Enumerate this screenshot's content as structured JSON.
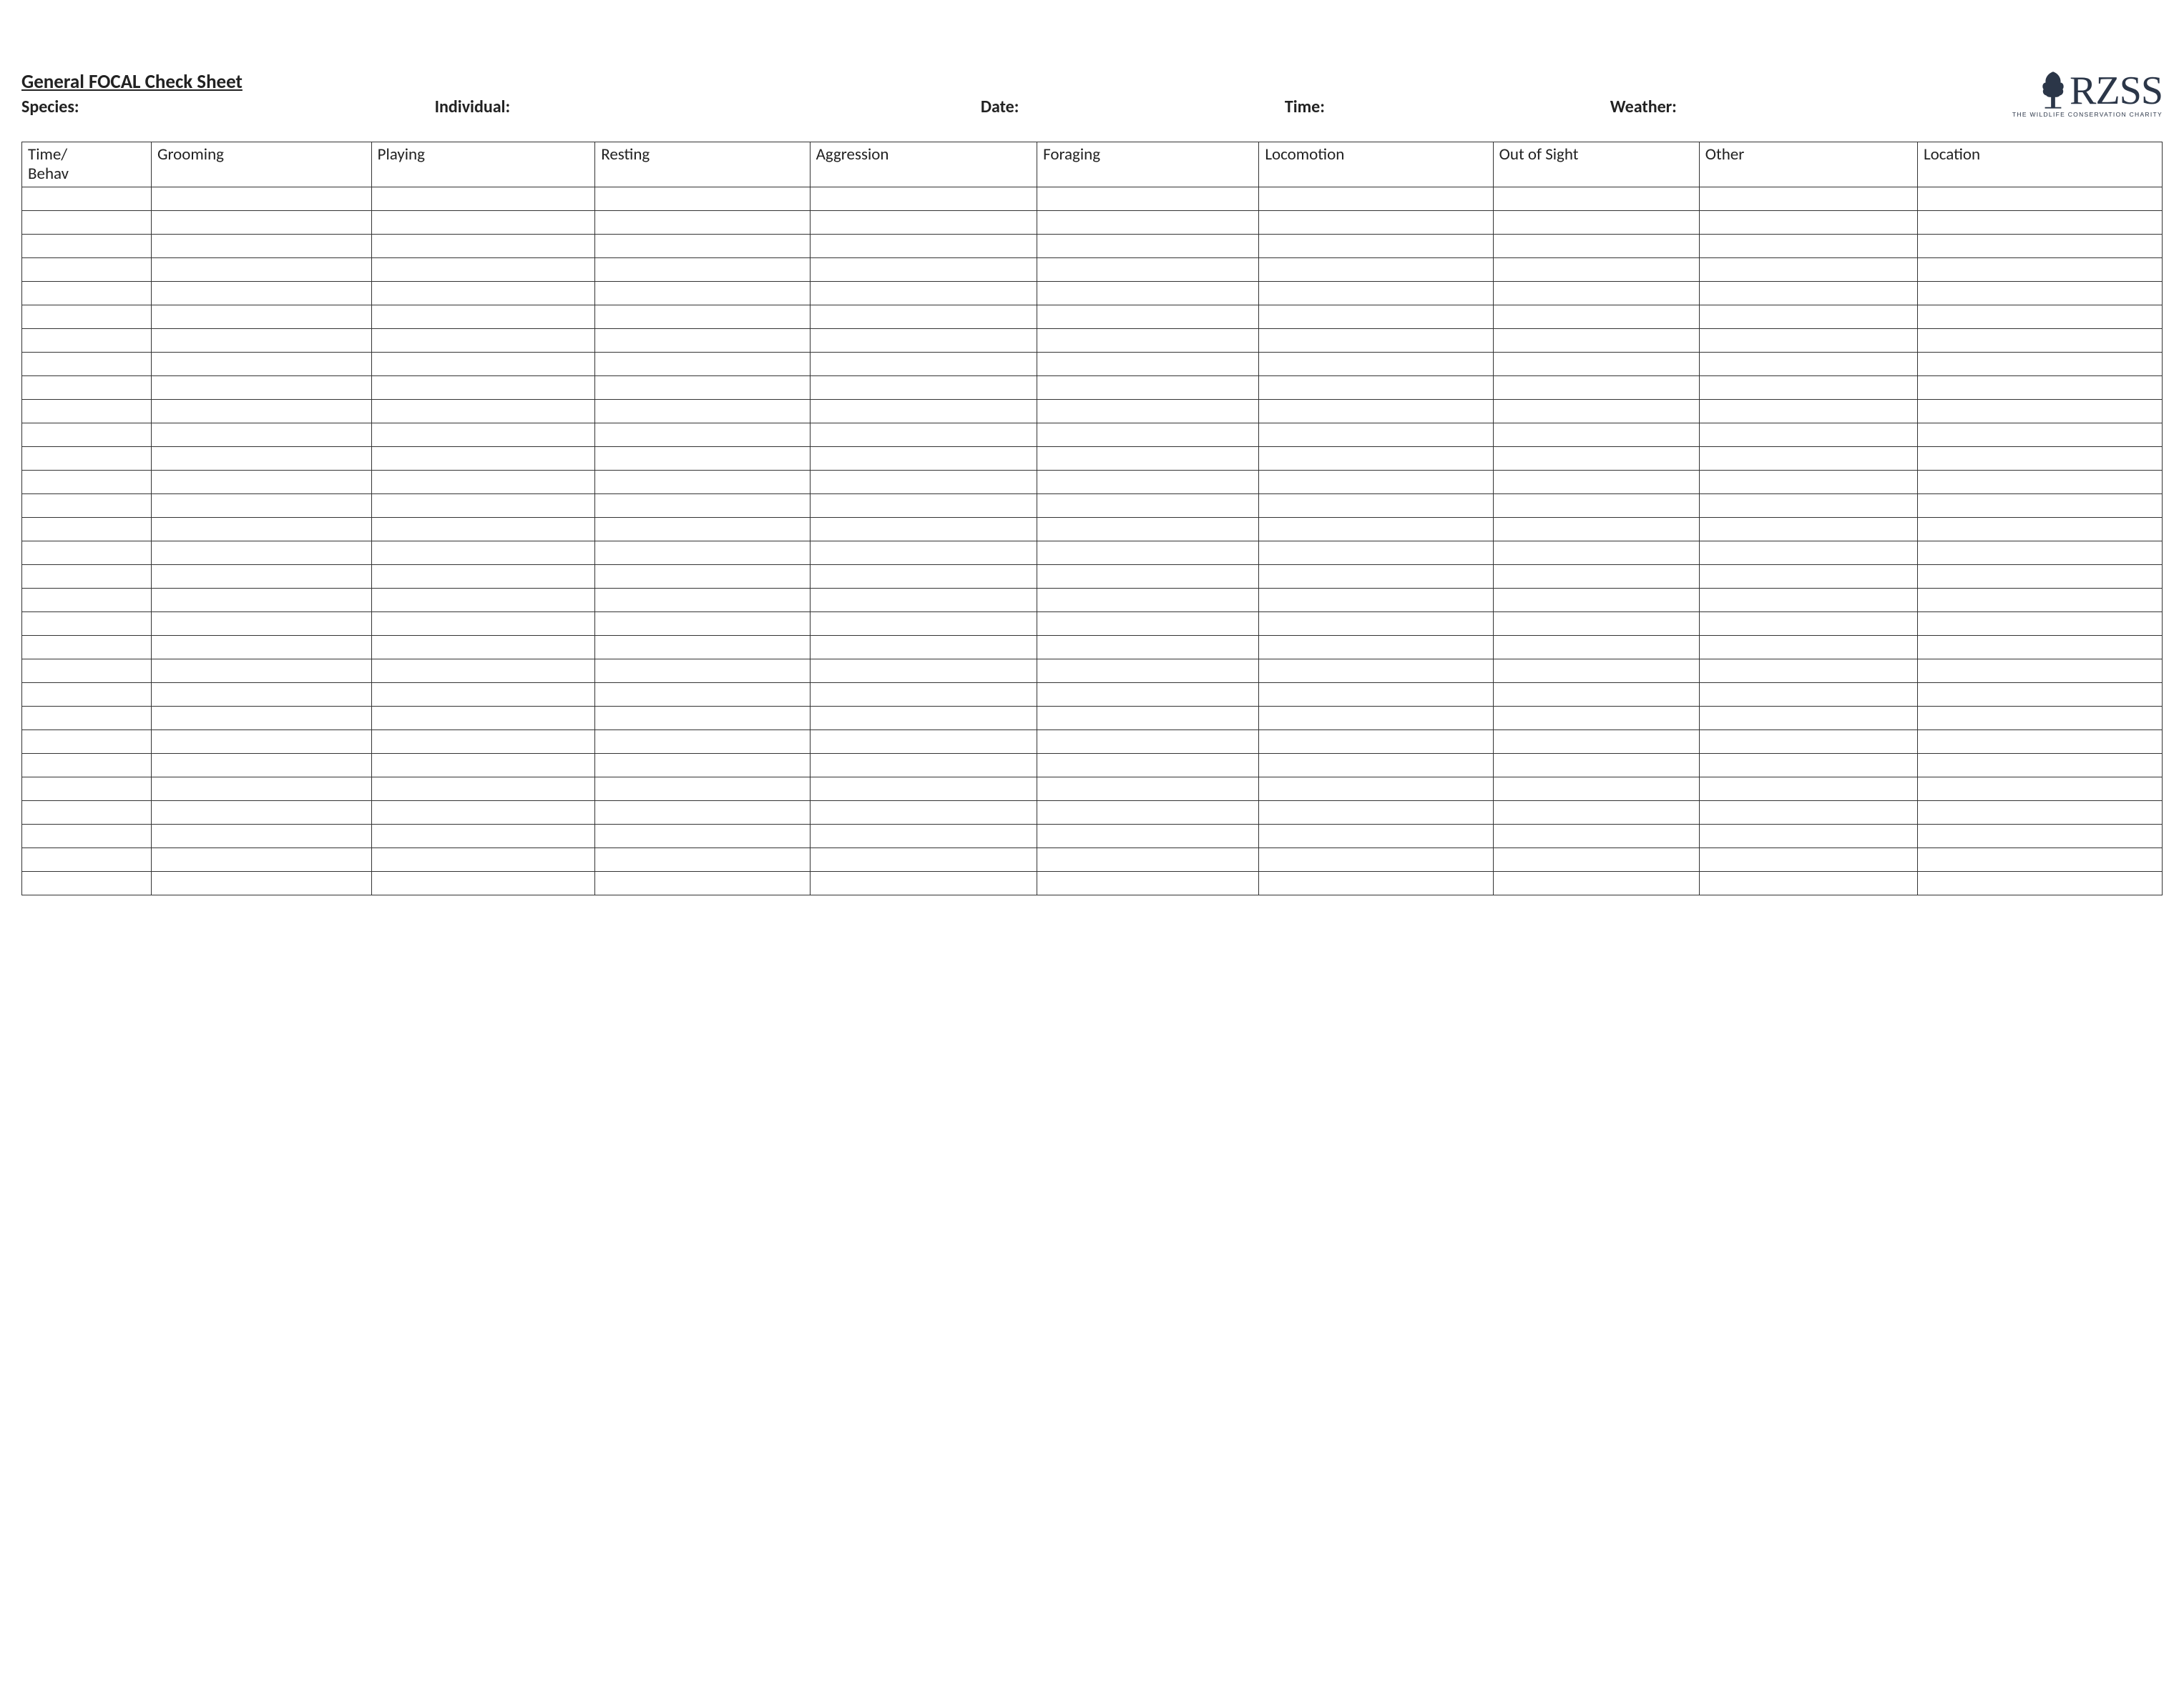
{
  "logo": {
    "text": "RZSS",
    "tagline": "THE WILDLIFE CONSERVATION CHARITY",
    "icon": "tree-icon"
  },
  "title": "General FOCAL Check Sheet",
  "meta": {
    "species_label": "Species:",
    "individual_label": "Individual:",
    "date_label": "Date:",
    "time_label": "Time:",
    "weather_label": "Weather:"
  },
  "table": {
    "headers": [
      "Time/\nBehav",
      "Grooming",
      "Playing",
      "Resting",
      "Aggression",
      "Foraging",
      "Locomotion",
      "Out of Sight",
      "Other",
      "Location"
    ],
    "row_count": 30,
    "col_count": 10
  }
}
